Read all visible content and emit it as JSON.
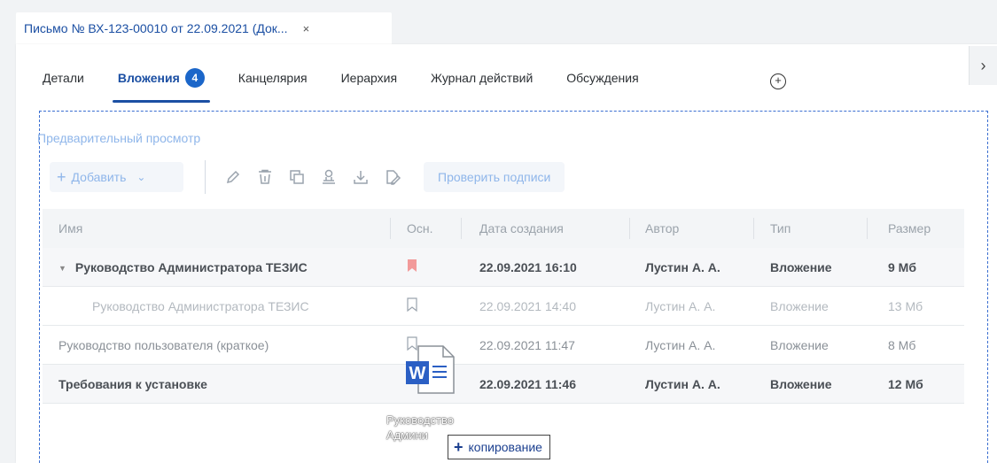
{
  "document_tab": {
    "title": "Письмо № ВХ-123-00010 от 22.09.2021 (Док...",
    "close": "×"
  },
  "tabs": [
    {
      "label": "Детали"
    },
    {
      "label": "Вложения",
      "badge": "4"
    },
    {
      "label": "Канцелярия"
    },
    {
      "label": "Иерархия"
    },
    {
      "label": "Журнал действий"
    },
    {
      "label": "Обсуждения"
    }
  ],
  "tab_add": "+",
  "panel_toggle": "›",
  "preview_link": "Предварительный просмотр",
  "toolbar": {
    "add_label": "Добавить",
    "add_plus": "+",
    "add_chevron": "⌄",
    "check_signatures": "Проверить подписи"
  },
  "table": {
    "headers": [
      "Имя",
      "Осн.",
      "Дата создания",
      "Автор",
      "Тип",
      "Размер"
    ],
    "rows": [
      {
        "expander": "▼",
        "name": "Руководство Администратора ТЕЗИС",
        "date": "22.09.2021 16:10",
        "author": "Лустин А. А.",
        "type": "Вложение",
        "size": "9 Мб"
      },
      {
        "name": "Руководство Администратора ТЕЗИС",
        "date": "22.09.2021 14:40",
        "author": "Лустин А. А.",
        "type": "Вложение",
        "size": "13 Мб"
      },
      {
        "name": "Руководство пользователя (краткое)",
        "date": "22.09.2021 11:47",
        "author": "Лустин А. А.",
        "type": "Вложение",
        "size": "8 Мб"
      },
      {
        "name": "Требования к установке",
        "date": "22.09.2021 11:46",
        "author": "Лустин А. А.",
        "type": "Вложение",
        "size": "12 Мб"
      }
    ]
  },
  "drag": {
    "file_label_1": "Руководство",
    "file_label_2": "Админи",
    "word_letter": "W",
    "copy_plus": "+",
    "copy_label": "копирование"
  },
  "colors": {
    "accent": "#1b4fa3",
    "badge": "#1b66c9",
    "main_flag": "#f29a9a",
    "word_blue": "#2b5fc4"
  }
}
